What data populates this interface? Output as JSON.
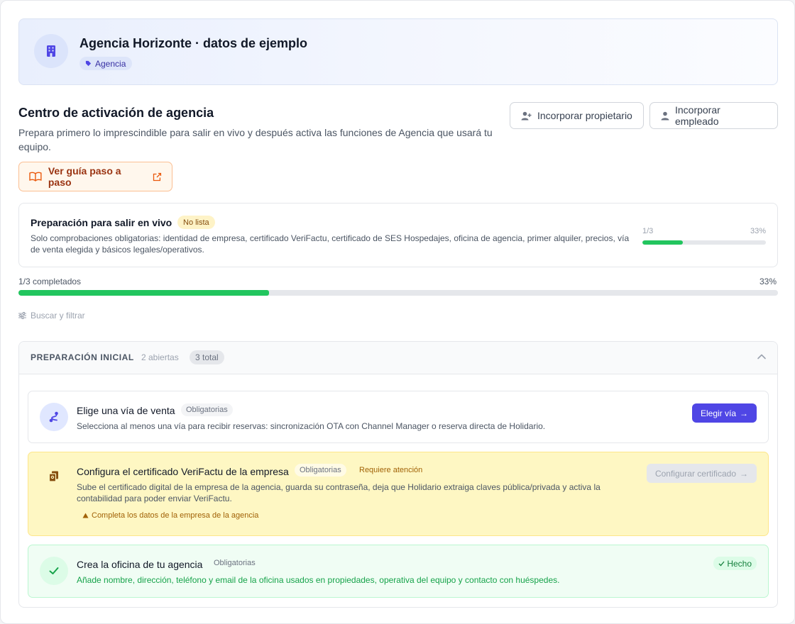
{
  "org": {
    "title": "Agencia Horizonte · datos de ejemplo",
    "tag": "Agencia",
    "icon": "building-icon"
  },
  "hub": {
    "title": "Centro de activación de agencia",
    "subtitle": "Prepara primero lo imprescindible para salir en vivo y después activa las funciones de Agencia que usará tu equipo.",
    "add_owner_label": "Incorporar propietario",
    "add_employee_label": "Incorporar empleado",
    "guide_label": "Ver guía paso a paso"
  },
  "readiness": {
    "title": "Preparación para salir en vivo",
    "badge": "No lista",
    "description": "Solo comprobaciones obligatorias: identidad de empresa, certificado VeriFactu, certificado de SES Hospedajes, oficina de agencia, primer alquiler, precios, vía de venta elegida y básicos legales/operativos.",
    "count": "1/3",
    "percent_label": "33%",
    "progress": 0.33
  },
  "overall": {
    "label": "1/3 completados",
    "percent_label": "33%",
    "progress": 0.33
  },
  "filter_label": "Buscar y filtrar",
  "group": {
    "title": "PREPARACIÓN INICIAL",
    "open": "2 abiertas",
    "total": "3 total"
  },
  "tasks": [
    {
      "title": "Elige una vía de venta",
      "chip": "Obligatorias",
      "description": "Selecciona al menos una vía para recibir reservas: sincronización OTA con Channel Manager o reserva directa de Holidario.",
      "action": "Elegir vía",
      "icon": "route-icon",
      "state": "open"
    },
    {
      "title": "Configura el certificado VeriFactu de la empresa",
      "chip": "Obligatorias",
      "status": "Requiere atención",
      "description": "Sube el certificado digital de la empresa de la agencia, guarda su contraseña, deja que Holidario extraiga claves pública/privada y activa la contabilidad para poder enviar VeriFactu.",
      "warning": "Completa los datos de la empresa de la agencia",
      "action": "Configurar certificado",
      "icon": "certificate-icon",
      "state": "attention"
    },
    {
      "title": "Crea la oficina de tu agencia",
      "chip": "Obligatorias",
      "description": "Añade nombre, dirección, teléfono y email de la oficina usados en propiedades, operativa del equipo y contacto con huéspedes.",
      "done_label": "Hecho",
      "icon": "check-icon",
      "state": "done"
    }
  ],
  "colors": {
    "primary": "#4f46e5",
    "success": "#22c55e",
    "warning_bg": "#fef7c3",
    "done_bg": "#f0fdf4"
  }
}
